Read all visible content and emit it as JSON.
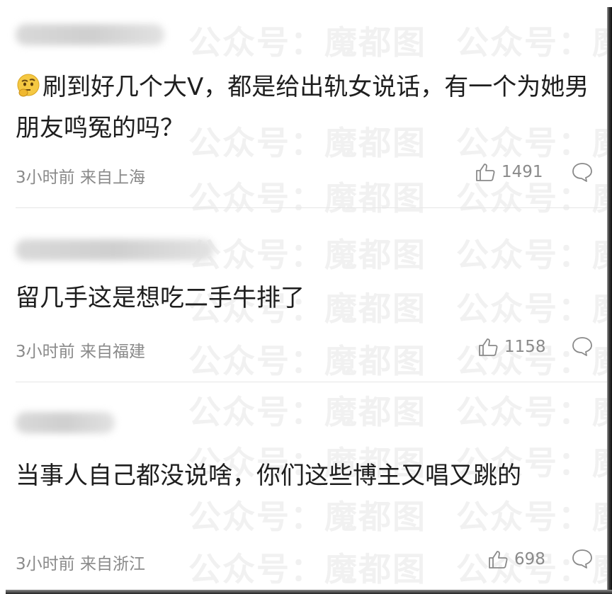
{
  "watermark": "公众号：魔都图",
  "comments": [
    {
      "text": "刷到好几个大V，都是给出轨女说话，有一个为她男朋友鸣冤的吗？",
      "emoji": "thinking-face",
      "time": "3小时前",
      "location": "来自上海",
      "likes": "1491"
    },
    {
      "text": "留几手这是想吃二手牛排了",
      "time": "3小时前",
      "location": "来自福建",
      "likes": "1158"
    },
    {
      "text": "当事人自己都没说啥，你们这些博主又唱又跳的",
      "time": "3小时前",
      "location": "来自浙江",
      "likes": "698"
    }
  ],
  "icons": {
    "like": "thumbs-up-icon",
    "reply": "comment-bubble-icon"
  },
  "colors": {
    "text": "#1e1e1e",
    "meta": "#8a8a8a",
    "divider": "#e6e6e6"
  }
}
